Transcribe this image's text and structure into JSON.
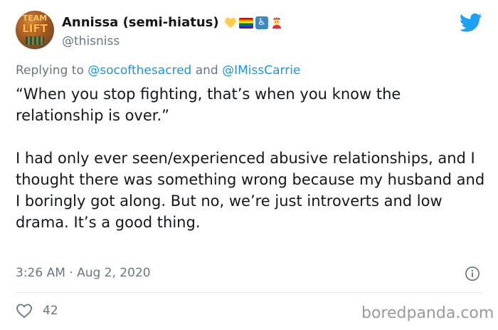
{
  "author": {
    "display_name": "Annissa (semi-hiatus)",
    "handle": "@thisniss",
    "avatar_text_top": "TEAM",
    "avatar_text_mid": "LIFT",
    "name_emojis": [
      "yellow-heart-icon",
      "rainbow-flag-icon",
      "wheelchair-accessibility-icon",
      "person-icon"
    ]
  },
  "reply": {
    "prefix": "Replying to",
    "mention_1": "@socofthesacred",
    "joiner": "and",
    "mention_2": "@IMissCarrie"
  },
  "tweet": {
    "paragraph_1": "“When you stop fighting, that’s when you know the relationship is over.”",
    "paragraph_2": "I had only ever seen/experienced abusive relationships, and I thought there was something wrong because my husband and I boringly got along. But no, we’re just introverts and low drama. It’s a good thing."
  },
  "meta": {
    "timestamp": "3:26 AM · Aug 2, 2020",
    "like_count": "42"
  },
  "icons": {
    "brand": "twitter-bird-icon",
    "info": "info-icon",
    "like": "heart-outline-icon"
  },
  "colors": {
    "brand_blue": "#1da1f2",
    "mention_blue": "#1b95e0",
    "secondary_text": "#657786",
    "primary_text": "#14171a",
    "divider": "#e1e8ed"
  },
  "watermark": "boredpanda.com"
}
